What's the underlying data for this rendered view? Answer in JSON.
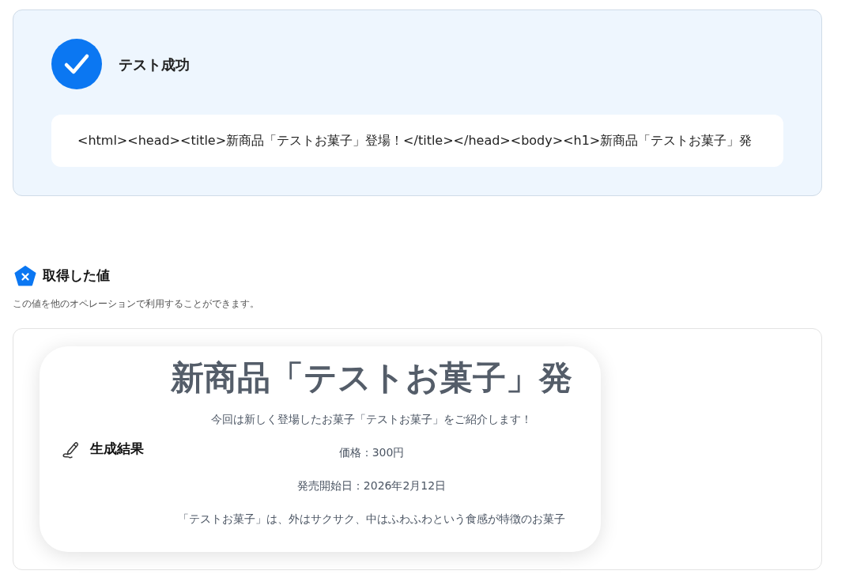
{
  "test_result": {
    "success": true,
    "title": "テスト成功",
    "output": "<html><head><title>新商品「テストお菓子」登場！</title></head><body><h1>新商品「テストお菓子」発"
  },
  "obtained_values": {
    "title": "取得した値",
    "description": "この値を他のオペレーションで利用することができます。"
  },
  "result_card": {
    "label": "生成結果",
    "preview": {
      "heading": "新商品「テストお菓子」発",
      "paragraphs": [
        "今回は新しく登場したお菓子「テストお菓子」をご紹介します！",
        "価格：300円",
        "発売開始日：2026年2月12日",
        "「テストお菓子」は、外はサクサク、中はふわふわという食感が特徴のお菓子"
      ]
    }
  }
}
